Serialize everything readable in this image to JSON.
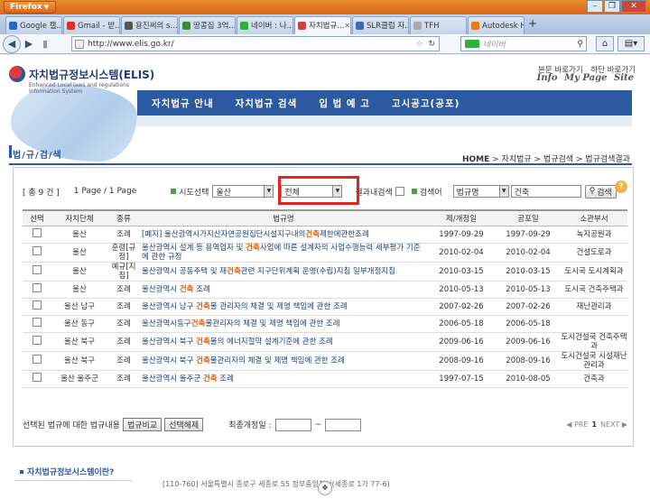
{
  "browser": {
    "app_label": "Firefox",
    "tabs": [
      {
        "label": "Google 캘...",
        "color": "#2a66c7",
        "active": false
      },
      {
        "label": "Gmail - 받...",
        "color": "#d93025",
        "active": false
      },
      {
        "label": "용진써의 s...",
        "color": "#555555",
        "active": false
      },
      {
        "label": "땅콩집 3억...",
        "color": "#3b8a3b",
        "active": false
      },
      {
        "label": "네이버 : 나...",
        "color": "#2db039",
        "active": false
      },
      {
        "label": "자치법규...",
        "color": "#c44",
        "active": true
      },
      {
        "label": "SLR클럽 자...",
        "color": "#4169b0",
        "active": false
      },
      {
        "label": "TFH",
        "color": "#aaaaaa",
        "active": false
      },
      {
        "label": "Autodesk H...",
        "color": "#e87b14",
        "active": false
      }
    ],
    "new_tab": "+",
    "url": "http://www.elis.go.kr/",
    "search_placeholder": "네이버"
  },
  "site": {
    "logo_title": "자치법규정보시스템(ELIS)",
    "logo_sub1": "Enhanced Local laws and regulations",
    "logo_sub2": "Information System",
    "toplink1": "본문 바로가기",
    "toplink2": "하단 바로가기",
    "sitelink1": "Info",
    "sitelink2": "My Page",
    "sitelink3": "Site",
    "menu": [
      "자치법규 안내",
      "자치법규 검색",
      "입 법 예 고",
      "고시공고(공포)"
    ],
    "section_title": "법/규/검/색",
    "breadcrumb_home": "HOME",
    "breadcrumb_rest": " > 자치법규 > 법규검색 > 법규검색결과"
  },
  "search": {
    "count": "[ 총 9 건 ]",
    "page_info": "1 Page / 1 Page",
    "region_label": "시도선택",
    "region_value": "울산",
    "district_value": "전체",
    "within_label": "결과내검색",
    "search_label": "검색어",
    "field_value": "법규명",
    "keyword_value": "건축",
    "search_button": "검색",
    "help": "?"
  },
  "table": {
    "headers": [
      "선택",
      "자치단체",
      "종류",
      "법규명",
      "제/개정일",
      "공포일",
      "소관부서"
    ],
    "rows": [
      {
        "org": "울산",
        "kind": "조례",
        "pre": "[폐지] 울산광역시가지산자연공원집단시설지구내의",
        "kw": "건축",
        "post": "제한에관한조례",
        "d1": "1997-09-29",
        "d2": "1997-09-29",
        "dept": "녹지공원과"
      },
      {
        "org": "울산",
        "kind": "훈령[규정]",
        "pre": "울산광역시 설계 등 용역업자 및 ",
        "kw": "건축",
        "post": "사업에 따른 설계자의 사업수행능력 세부평가 기준에 관한 규정",
        "d1": "2010-02-04",
        "d2": "2010-02-04",
        "dept": "건설도로과"
      },
      {
        "org": "울산",
        "kind": "예규[지침]",
        "pre": "울산광역시 공동주택 및 재",
        "kw": "건축",
        "post": "관련 지구단위계획 운영(수립)지침 일부개정지침",
        "d1": "2010-03-15",
        "d2": "2010-03-15",
        "dept": "도시국 도시계획과"
      },
      {
        "org": "울산",
        "kind": "조례",
        "pre": "울산광역시 ",
        "kw": "건축",
        "post": " 조례",
        "d1": "2010-05-13",
        "d2": "2010-05-13",
        "dept": "도시국 건축주택과"
      },
      {
        "org": "울산 남구",
        "kind": "조례",
        "pre": "울산광역시 남구 ",
        "kw": "건축",
        "post": "물 관리자의 체결 및 제명 책임에 관한 조례",
        "d1": "2007-02-26",
        "d2": "2007-02-26",
        "dept": "재난관리과"
      },
      {
        "org": "울산 동구",
        "kind": "조례",
        "pre": "울산광역시동구",
        "kw": "건축",
        "post": "물관리자의 체결 및 제명 책임에 관한 조례",
        "d1": "2006-05-18",
        "d2": "2006-05-18",
        "dept": ""
      },
      {
        "org": "울산 북구",
        "kind": "조례",
        "pre": "울산광역시 북구 ",
        "kw": "건축",
        "post": "물의 에너지절약 설계기준에 관한 조례",
        "d1": "2009-06-16",
        "d2": "2009-06-16",
        "dept": "도시건설국 건축주택과"
      },
      {
        "org": "울산 북구",
        "kind": "조례",
        "pre": "울산광역시 북구 ",
        "kw": "건축",
        "post": "물관리자의 체결 및 제명 책임에 관한 조례",
        "d1": "2008-09-16",
        "d2": "2008-09-16",
        "dept": "도시건설국 시설재난관리과"
      },
      {
        "org": "울산 울주군",
        "kind": "조례",
        "pre": "울산광역시 울주군 ",
        "kw": "건축",
        "post": " 조례",
        "d1": "1997-07-15",
        "d2": "2010-08-05",
        "dept": "건축과"
      }
    ]
  },
  "footer": {
    "selected_label": "선택된 법규에 대한 법규내용",
    "compare_button": "법규비교",
    "clear_button": "선택해제",
    "date_label": "최종개정일 :",
    "tilde": "~",
    "prev": "◀ PRE",
    "page": "1",
    "next": "NEXT ▶"
  },
  "bottom": {
    "title": "자치법규정보시스템이란?",
    "address": "[110-760] 서울특별시 종로구 세종로 55 정부중앙청사(세종로 1가 77-6)"
  }
}
